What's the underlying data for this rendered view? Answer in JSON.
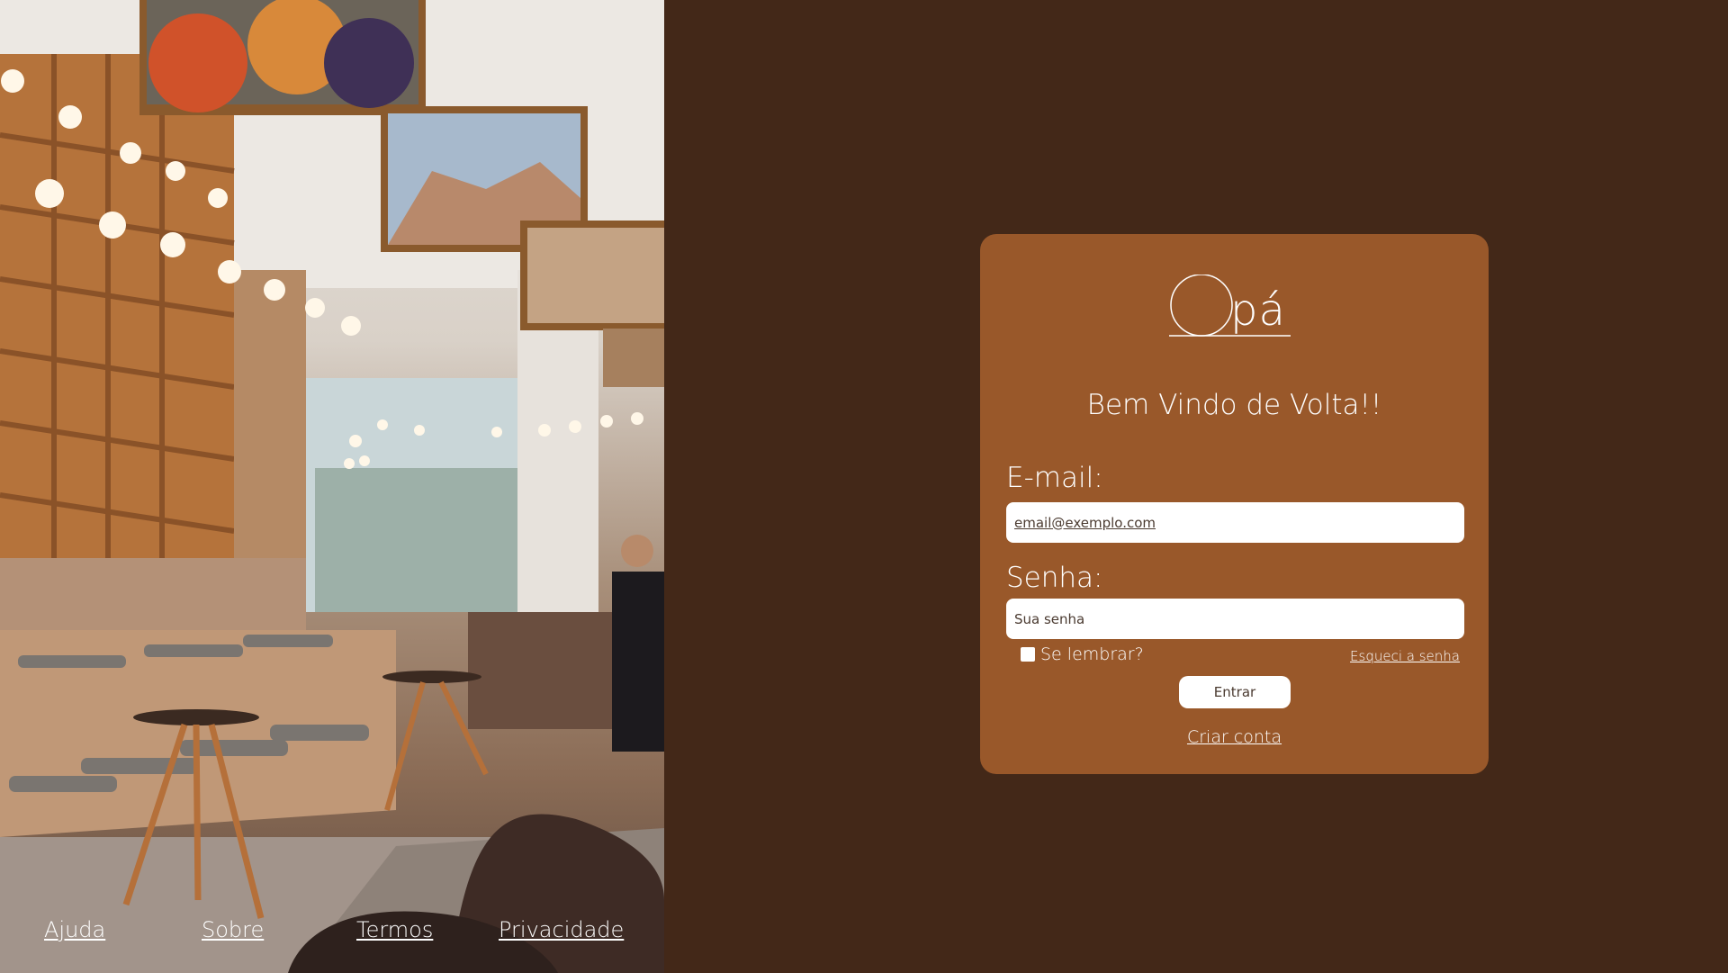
{
  "footer": {
    "links": [
      "Ajuda",
      "Sobre",
      "Termos",
      "Privacidade"
    ]
  },
  "card": {
    "logo_text": "pá",
    "welcome": "Bem Vindo de Volta!!",
    "email_label": "E-mail:",
    "email_placeholder": "email@exemplo.com",
    "password_label": "Senha:",
    "password_placeholder": "Sua senha",
    "remember_label": "Se lembrar?",
    "forgot_label": "Esqueci a senha",
    "submit_label": "Entrar",
    "create_label": "Criar conta"
  },
  "colors": {
    "background": "#432818",
    "card": "#99582a",
    "text": "#ffffff"
  }
}
